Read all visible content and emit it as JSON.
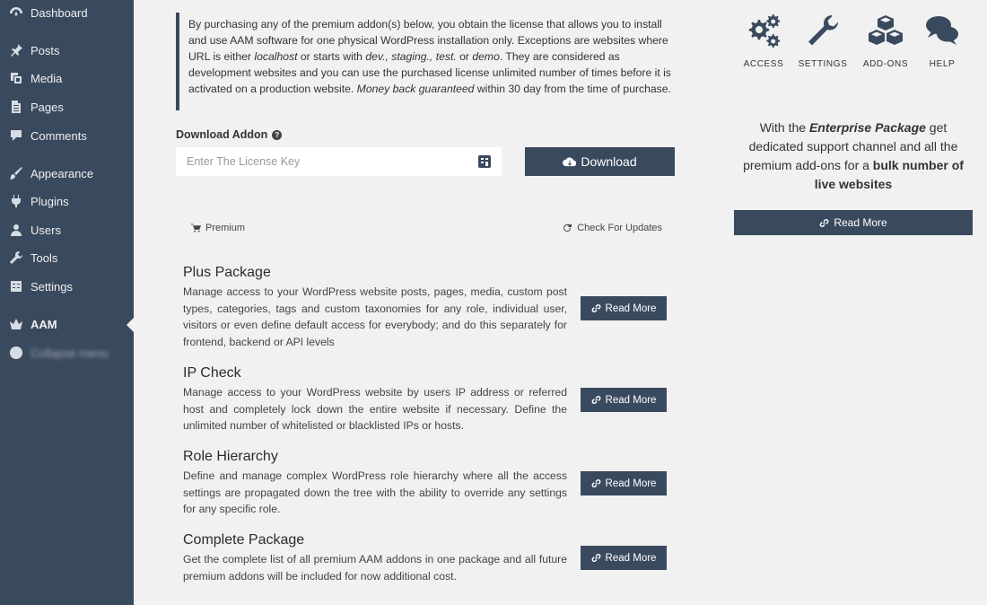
{
  "sidebar": {
    "items": [
      {
        "label": "Dashboard",
        "icon": "dashboard-icon"
      },
      {
        "label": "Posts",
        "icon": "pin-icon"
      },
      {
        "label": "Media",
        "icon": "media-icon"
      },
      {
        "label": "Pages",
        "icon": "pages-icon"
      },
      {
        "label": "Comments",
        "icon": "comments-icon"
      },
      {
        "label": "Appearance",
        "icon": "brush-icon"
      },
      {
        "label": "Plugins",
        "icon": "plug-icon"
      },
      {
        "label": "Users",
        "icon": "users-icon"
      },
      {
        "label": "Tools",
        "icon": "wrench-icon"
      },
      {
        "label": "Settings",
        "icon": "settings-icon"
      },
      {
        "label": "AAM",
        "icon": "aam-icon"
      },
      {
        "label": "Collapse menu",
        "icon": "collapse-icon"
      }
    ]
  },
  "notice": {
    "p1": "By purchasing any of the premium addon(s) below, you obtain the license that allows you to install and use AAM software for one physical WordPress installation only. Exceptions are websites where URL is either ",
    "localhost": "localhost",
    "p2": " or starts with ",
    "prefixes": "dev., staging., test.",
    "p3": " or ",
    "demo": "demo",
    "p4": ". They are considered as development websites and you can use the purchased license unlimited number of times before it is activated on a production website. ",
    "guarantee": "Money back guaranteed",
    "p5": " within 30 day from the time of purchase."
  },
  "download": {
    "label": "Download Addon",
    "help": "?",
    "placeholder": "Enter The License Key",
    "button": "Download"
  },
  "tabs": {
    "premium": "Premium",
    "check_updates": "Check For Updates"
  },
  "addons": [
    {
      "title": "Plus Package",
      "desc": "Manage access to your WordPress website posts, pages, media, custom post types, categories, tags and custom taxonomies for any role, individual user, visitors or even define default access for everybody; and do this separately for frontend, backend or API levels",
      "button": "Read More"
    },
    {
      "title": "IP Check",
      "desc": "Manage access to your WordPress website by users IP address or referred host and completely lock down the entire website if necessary. Define the unlimited number of whitelisted or blacklisted IPs or hosts.",
      "button": "Read More"
    },
    {
      "title": "Role Hierarchy",
      "desc": "Define and manage complex WordPress role hierarchy where all the access settings are propagated down the tree with the ability to override any settings for any specific role.",
      "button": "Read More"
    },
    {
      "title": "Complete Package",
      "desc": "Get the complete list of all premium AAM addons in one package and all future premium addons will be included for now additional cost.",
      "button": "Read More"
    }
  ],
  "top_nav": [
    {
      "label": "ACCESS",
      "icon": "cogs-icon"
    },
    {
      "label": "SETTINGS",
      "icon": "wrench-icon"
    },
    {
      "label": "ADD-ONS",
      "icon": "cubes-icon"
    },
    {
      "label": "HELP",
      "icon": "chat-icon"
    }
  ],
  "promo": {
    "t1": "With the ",
    "enterprise": "Enterprise Package",
    "t2": " get dedicated support channel and all the premium add-ons for a ",
    "bulk": "bulk number of live websites",
    "button": "Read More"
  },
  "colors": {
    "sidebar": "#3a4a5e",
    "accent": "#3a4a5e",
    "background": "#f1f1f1"
  }
}
